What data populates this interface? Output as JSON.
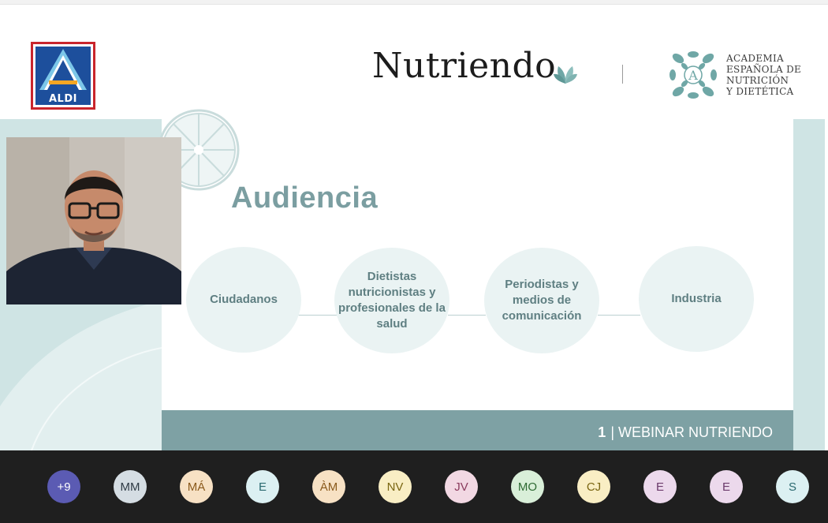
{
  "header": {
    "aldi_logo_text": "ALDI",
    "nutriendo_title": "Nutriendo",
    "academia_lines": [
      "ACADEMIA",
      "ESPAÑOLA DE",
      "NUTRICIÓN",
      "Y DIETÉTICA"
    ],
    "academia_emblem_letter": "A"
  },
  "slide": {
    "heading": "Audiencia",
    "audiences": [
      {
        "label": "Ciudadanos"
      },
      {
        "label": "Dietistas nutricionistas y profesionales de la salud"
      },
      {
        "label": "Periodistas y medios de comunicación"
      },
      {
        "label": "Industria"
      }
    ],
    "footer_page": "1",
    "footer_label": "| WEBINAR NUTRIENDO"
  },
  "participants": [
    {
      "initials": "+9",
      "bg": "#5b5bb3",
      "fg": "#ffffff"
    },
    {
      "initials": "MM",
      "bg": "#d5dde3",
      "fg": "#2f3b45"
    },
    {
      "initials": "MÁ",
      "bg": "#f7e1c4",
      "fg": "#8a5a1c"
    },
    {
      "initials": "E",
      "bg": "#dcf0f2",
      "fg": "#2b6a70"
    },
    {
      "initials": "ÀM",
      "bg": "#f7e1c4",
      "fg": "#8a5a1c"
    },
    {
      "initials": "NV",
      "bg": "#f9eec4",
      "fg": "#7a6612"
    },
    {
      "initials": "JV",
      "bg": "#f2d8e3",
      "fg": "#8a3b5d"
    },
    {
      "initials": "MO",
      "bg": "#d9efd9",
      "fg": "#2f6b34"
    },
    {
      "initials": "CJ",
      "bg": "#f9eec4",
      "fg": "#7a6612"
    },
    {
      "initials": "E",
      "bg": "#ecd9ec",
      "fg": "#6b3a6b"
    },
    {
      "initials": "E",
      "bg": "#ecd9ec",
      "fg": "#6b3a6b"
    },
    {
      "initials": "S",
      "bg": "#dcf0f2",
      "fg": "#2b6a70"
    }
  ],
  "colors": {
    "accent_teal": "#7ea1a4",
    "heading": "#7b9ea1",
    "aldi_red": "#c9252c",
    "aldi_blue": "#1d4f9c"
  }
}
